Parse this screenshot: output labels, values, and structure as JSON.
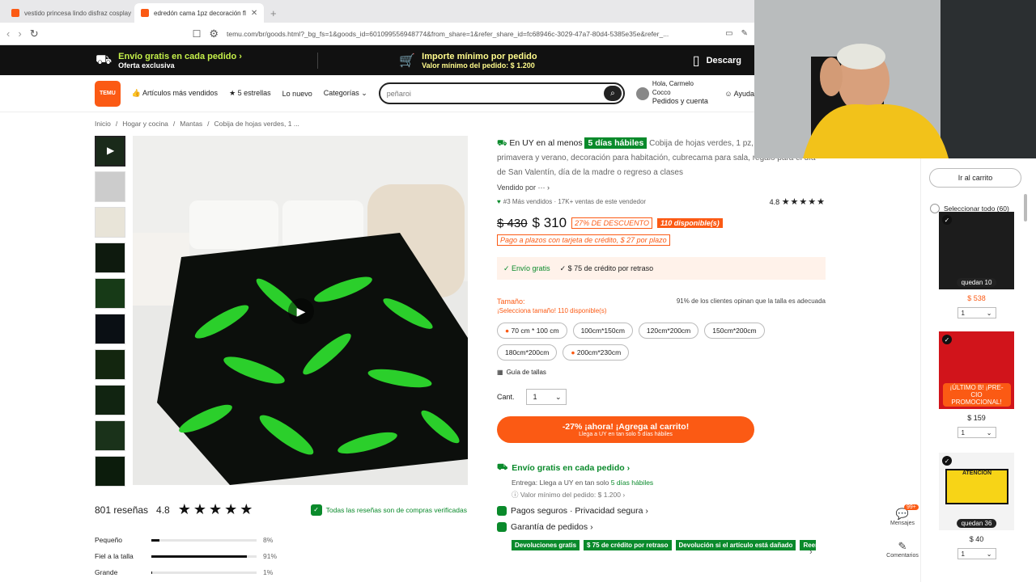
{
  "browser": {
    "tabs": [
      {
        "title": "vestido princesa lindo disfraz cosplay"
      },
      {
        "title": "edredón cama 1pz decoración fl"
      }
    ],
    "new_tab": "+",
    "url": "temu.com/br/goods.html?_bg_fs=1&goods_id=601099556948774&from_share=1&refer_share_id=fc68946c-3029-47a7-80d4-5385e35e&refer_..."
  },
  "promo": {
    "item1_title": "Envío gratis en cada pedido ›",
    "item1_sub": "Oferta exclusiva",
    "item2_title": "Importe mínimo por pedido",
    "item2_sub": "Valor mínimo del pedido: $ 1.200",
    "item3_title": "Descarg"
  },
  "header": {
    "logo": "TEMU",
    "nav": [
      "Artículos más vendidos",
      "5 estrellas",
      "Lo nuevo",
      "Categorías"
    ],
    "search_value": "peñaroi",
    "account_line1": "Hola, Carmelo Cocco",
    "account_line2": "Pedidos y cuenta",
    "help": "Ayuda"
  },
  "breadcrumb": [
    "Inicio",
    "Hogar y cocina",
    "Mantas",
    "Cobija de hojas verdes, 1 ..."
  ],
  "reviews": {
    "count": "801 reseñas",
    "score": "4.8",
    "stars": "★★★★★",
    "verified": "Todas las reseñas son de compras verificadas",
    "fit": [
      {
        "label": "Pequeño",
        "pct": "8%",
        "value": 8
      },
      {
        "label": "Fiel a la talla",
        "pct": "91%",
        "value": 91
      },
      {
        "label": "Grande",
        "pct": "1%",
        "value": 1
      }
    ]
  },
  "product": {
    "delivery_prefix": "En UY en al menos",
    "delivery_days": "5 días hábiles",
    "title": "Cobija de hojas verdes, 1 pz, decoración de primavera y verano, decoración para habitación, cubrecama para sala, regalo para el día de San Valentín, día de la madre o regreso a clases",
    "seller": "Vendido por ··· ›",
    "sold_rank": "#3 Más vendidos · 17K+ ventas de este vendedor",
    "rating": "4.8",
    "rating_stars": "★★★★★",
    "old_price": "$ 430",
    "new_price": "$ 310",
    "discount": "27% DE DESCUENTO",
    "available": "110 disponible(s)",
    "installments": "Pago a plazos con tarjeta de crédito, $ 27 por plazo",
    "free_shipping": "✓ Envío gratis",
    "credit": "✓ $ 75 de crédito por retraso",
    "size_label": "Tamaño:",
    "size_warning": "¡Selecciona tamaño! 110 disponible(s)",
    "fit_note": "91% de los clientes opinan que la talla es adecuada",
    "sizes": [
      "70 cm * 100 cm",
      "100cm*150cm",
      "120cm*200cm",
      "150cm*200cm",
      "180cm*200cm",
      "200cm*230cm"
    ],
    "size_guide": "Guía de tallas",
    "qty_label": "Cant.",
    "qty_value": "1",
    "cart_main": "-27% ¡ahora! ¡Agrega al carrito!",
    "cart_sub": "Llega a UY en tan solo 5 días hábiles"
  },
  "shipping": {
    "title": "Envío gratis en cada pedido ›",
    "delivery": "Entrega: Llega a UY en tan solo",
    "delivery_days": "5 días hábiles",
    "minimum": "Valor mínimo del pedido: $ 1.200 ›",
    "secure": "Pagos seguros · Privacidad segura ›",
    "guarantee": "Garantía de pedidos ›",
    "tags": [
      "Devoluciones gratis",
      "$ 75 de crédito por retraso",
      "Devolución si el artículo está dañado",
      "Reemb"
    ]
  },
  "sidebar": {
    "go_cart": "Ir al carrito",
    "select_all": "Seleccionar todo (60)",
    "items": [
      {
        "badge": "quedan 10",
        "price": "$ 538",
        "qty": "1"
      },
      {
        "badge": "¡ÚLTIMO B! ¡PRE-CIO PROMOCIONAL!",
        "price": "$ 159",
        "qty": "1"
      },
      {
        "badge": "quedan 36",
        "price": "$ 40",
        "qty": "1",
        "sign": "ATENCIÓN"
      }
    ],
    "messages": "Mensajes",
    "messages_badge": "99+",
    "comments": "Comentarios"
  }
}
